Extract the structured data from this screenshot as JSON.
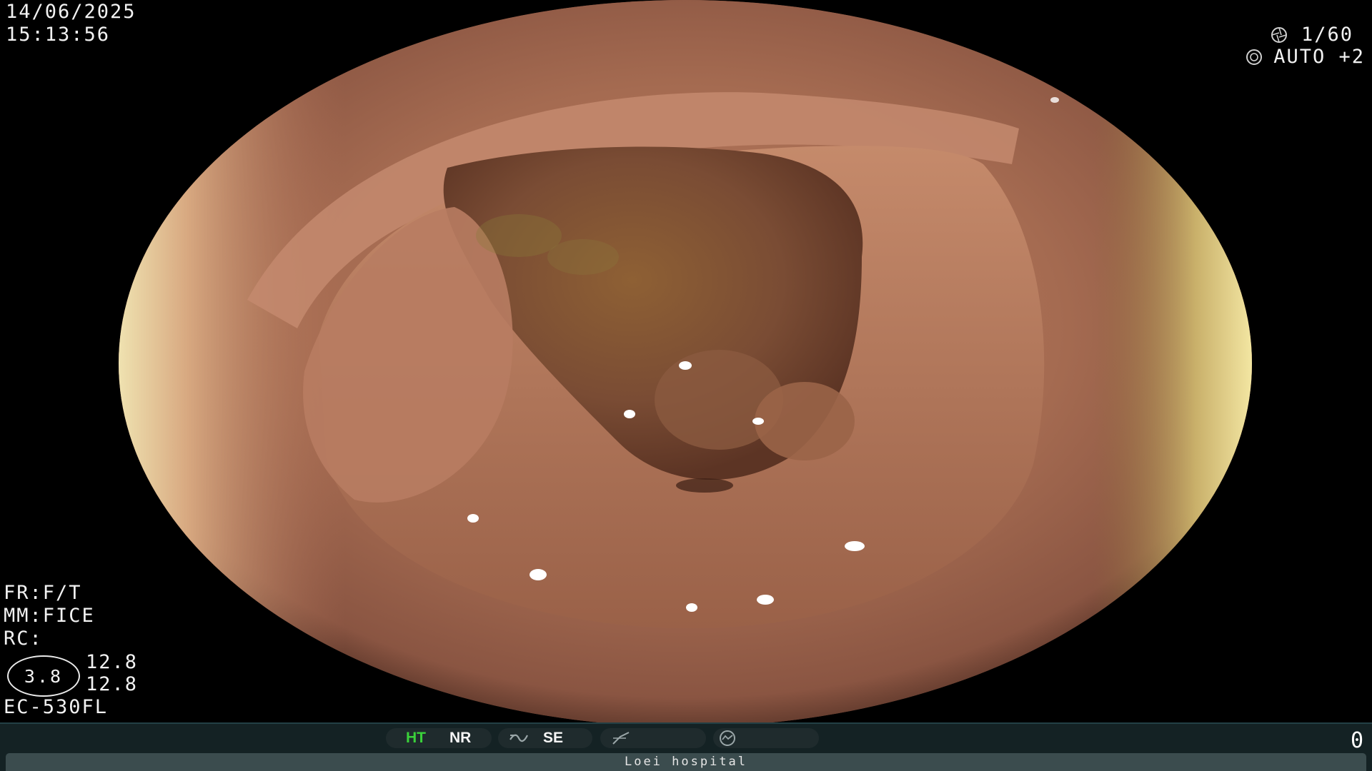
{
  "header": {
    "date": "14/06/2025",
    "time": "15:13:56"
  },
  "camera": {
    "shutter_speed": "1/60",
    "exposure": "AUTO +2"
  },
  "settings": {
    "fr": "FR:F/T",
    "mm": "MM:FICE",
    "rc": "RC:",
    "ratio_value": "3.8",
    "value_top": "12.8",
    "value_bottom": "12.8",
    "scope_model": "EC-530FL"
  },
  "status_bar": {
    "modes": [
      {
        "label": "HT",
        "color": "#3ad13a"
      },
      {
        "label": "NR",
        "color": "#f5f5f5"
      },
      {
        "label": "SE",
        "color": "#f5f5f5"
      }
    ],
    "frame_count": "0",
    "hospital": "Loei hospital"
  },
  "colors": {
    "osd_text": "#f2f2f2",
    "status_bar_bg": "#142224",
    "pill_bg": "#1f2b2d",
    "active_mode": "#3ad13a"
  },
  "icons": {
    "shutter": "aperture-icon",
    "exposure": "iris-icon",
    "structure_enhance": "signal-curve-icon",
    "slope": "slope-icon",
    "gauge": "gauge-icon"
  }
}
